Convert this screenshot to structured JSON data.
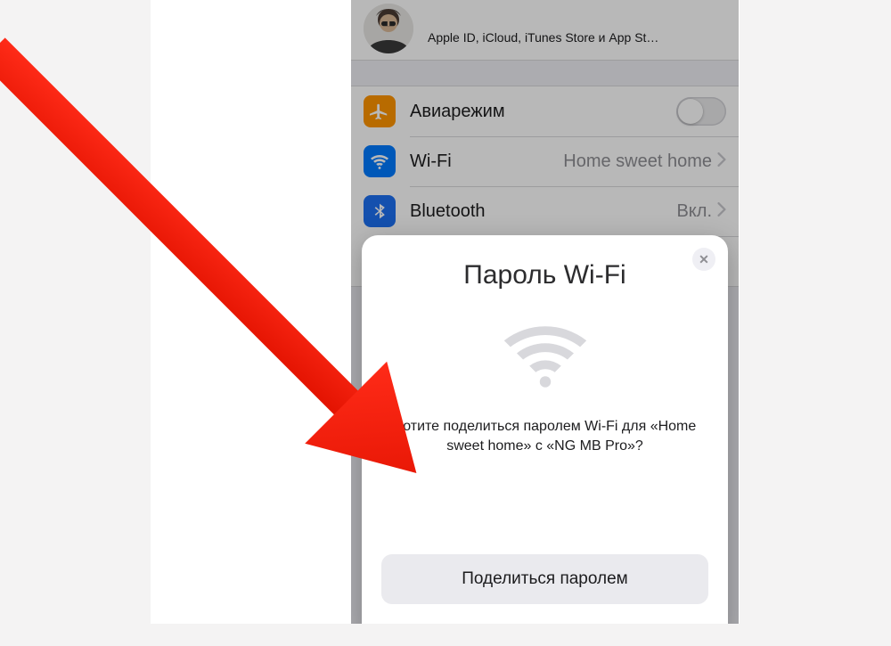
{
  "header": {
    "subtitle": "Apple ID, iCloud, iTunes Store и App St…"
  },
  "rows": {
    "airplane": {
      "label": "Авиарежим"
    },
    "wifi": {
      "label": "Wi-Fi",
      "value": "Home sweet home"
    },
    "bluetooth": {
      "label": "Bluetooth",
      "value": "Вкл."
    }
  },
  "sheet": {
    "title": "Пароль Wi-Fi",
    "message": "Хотите поделиться паролем Wi-Fi для «Home sweet home» с «NG MB Pro»?",
    "button": "Поделиться паролем"
  }
}
